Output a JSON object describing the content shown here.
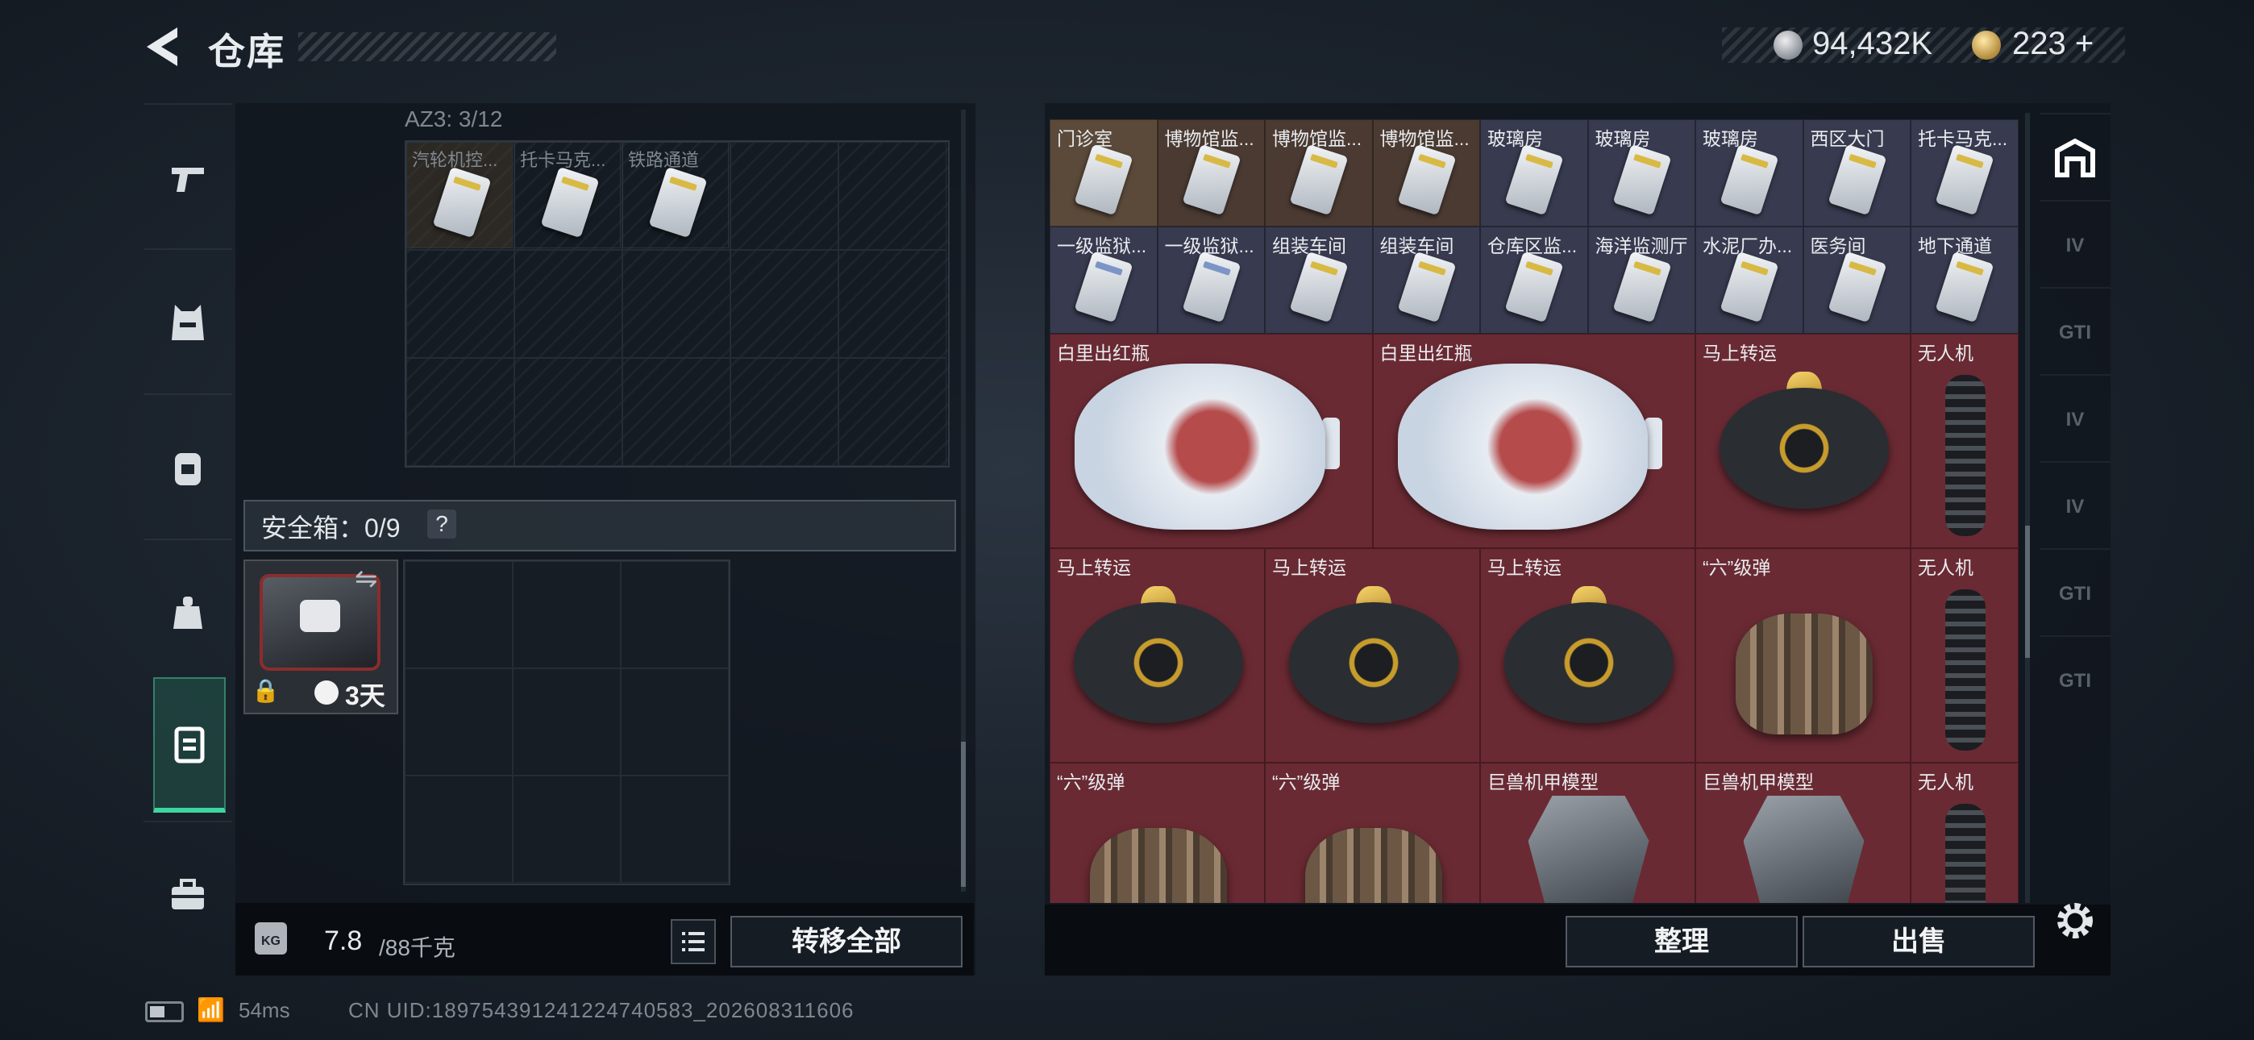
{
  "header": {
    "title": "仓库",
    "back_icon": "back-arrow-icon"
  },
  "currency": {
    "silver": "94,432K",
    "gold": "223",
    "gold_add": "+"
  },
  "left_tabs": [
    {
      "icon": "pistol-icon",
      "active": false
    },
    {
      "icon": "vest-icon",
      "active": false
    },
    {
      "icon": "backpack-icon",
      "active": false
    },
    {
      "icon": "rig-icon",
      "active": false
    },
    {
      "icon": "clipboard-icon",
      "active": true
    },
    {
      "icon": "briefcase-icon",
      "active": false
    }
  ],
  "az": {
    "label": "AZ3: 3/12",
    "keys": [
      "汽轮机控...",
      "托卡马克...",
      "铁路通道"
    ]
  },
  "safe": {
    "label": "安全箱：0/9",
    "help": "?",
    "days": "3天"
  },
  "weight": {
    "current": "7.8",
    "max": "/88千克",
    "kg": "KG"
  },
  "buttons": {
    "transfer": "转移全部",
    "sort": "整理",
    "sell": "出售"
  },
  "right_grid": {
    "key_row1": [
      "门诊室",
      "博物馆监...",
      "博物馆监...",
      "博物馆监...",
      "玻璃房",
      "玻璃房",
      "玻璃房",
      "西区大门",
      "托卡马克..."
    ],
    "key_row2": [
      "一级监狱...",
      "一级监狱...",
      "组装车间",
      "组装车间",
      "仓库区监...",
      "海洋监测厅",
      "水泥厂办...",
      "医务间",
      "地下通道"
    ],
    "large": [
      {
        "name": "白里出红瓶",
        "type": "vase"
      },
      {
        "name": "白里出红瓶",
        "type": "vase"
      },
      {
        "name": "马上转运",
        "type": "disc"
      },
      {
        "name": "无人机",
        "type": "drone"
      },
      {
        "name": "马上转运",
        "type": "disc"
      },
      {
        "name": "马上转运",
        "type": "disc"
      },
      {
        "name": "马上转运",
        "type": "disc"
      },
      {
        "name": "“六”级弹",
        "type": "fist"
      },
      {
        "name": "无人机",
        "type": "drone"
      },
      {
        "name": "“六”级弹",
        "type": "fist"
      },
      {
        "name": "“六”级弹",
        "type": "fist"
      },
      {
        "name": "巨兽机甲模型",
        "type": "mech"
      },
      {
        "name": "巨兽机甲模型",
        "type": "mech"
      },
      {
        "name": "无人机",
        "type": "drone"
      }
    ]
  },
  "right_tabs": [
    {
      "icon": "home-base-icon",
      "label": ""
    },
    {
      "icon": "tier-iv-folder-icon",
      "label": "IV"
    },
    {
      "icon": "gti-folder-icon",
      "label": "GTI"
    },
    {
      "icon": "tier-iv-folder-icon",
      "label": "IV"
    },
    {
      "icon": "tier-iv-folder-icon",
      "label": "IV"
    },
    {
      "icon": "gti-folder-icon",
      "label": "GTI"
    },
    {
      "icon": "gti-folder-icon",
      "label": "GTI"
    }
  ],
  "status": {
    "ping": "54ms",
    "uid": "CN UID:1897543912412247405​83_202608311606"
  }
}
